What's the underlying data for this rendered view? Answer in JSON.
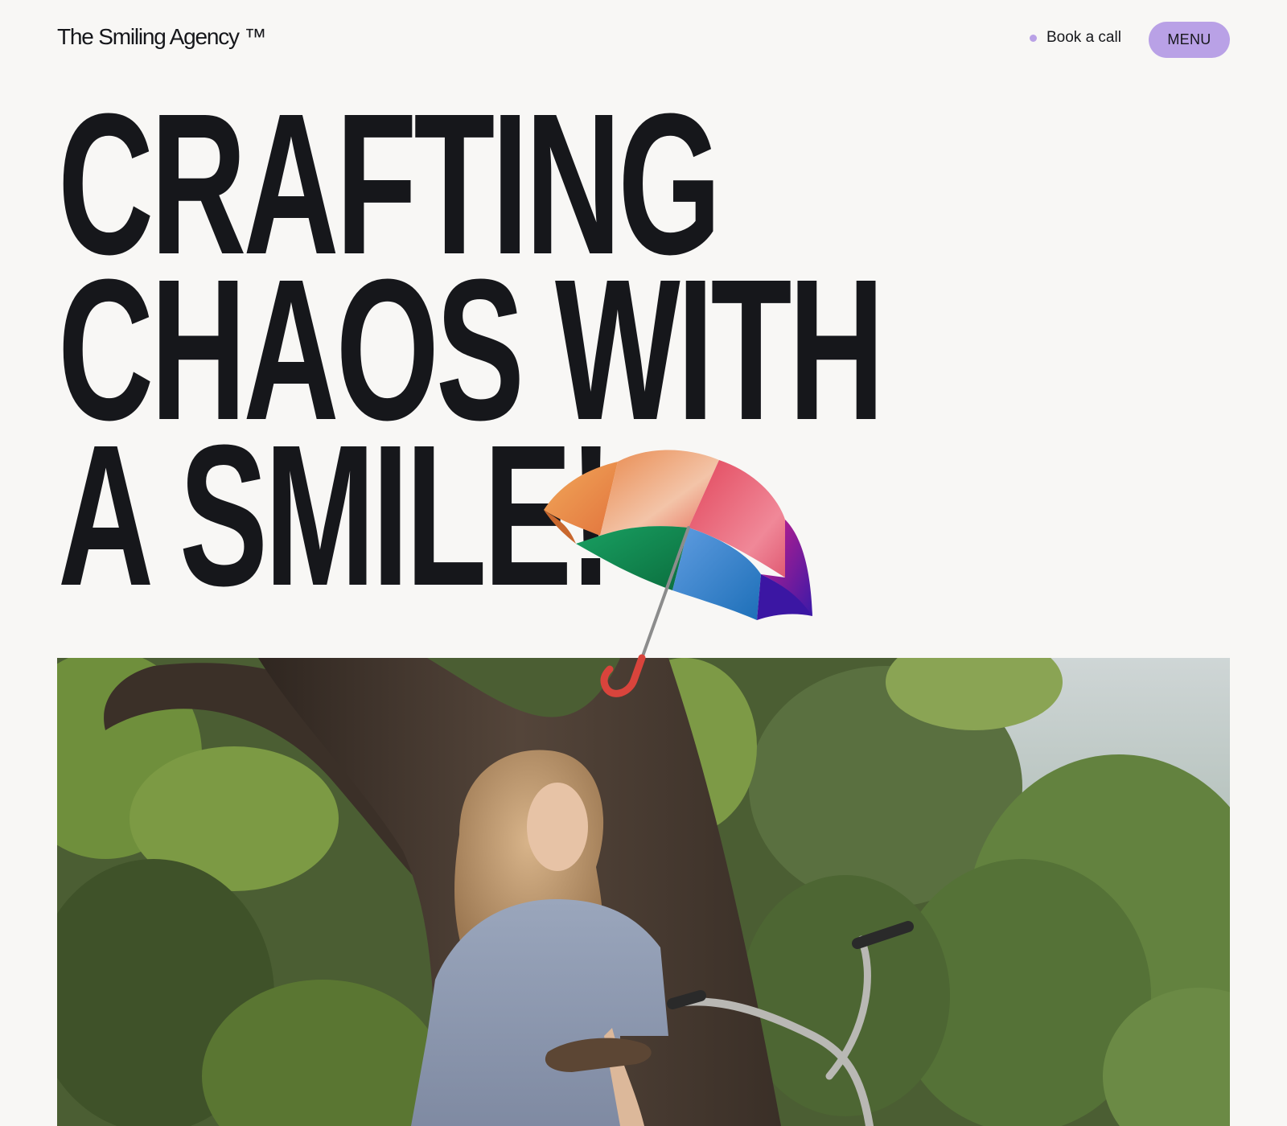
{
  "header": {
    "brand": "The Smiling Agency ™",
    "book_call_label": "Book a call",
    "menu_label": "MENU"
  },
  "hero": {
    "headline_lines": [
      "CRAFTING",
      "CHAOS WITH",
      "A SMILE!"
    ]
  },
  "icons": {
    "umbrella": "rainbow-umbrella",
    "book_call_dot": "dot-icon"
  },
  "colors": {
    "background": "#f8f7f5",
    "text": "#16171b",
    "accent": "#b9a1e6"
  }
}
